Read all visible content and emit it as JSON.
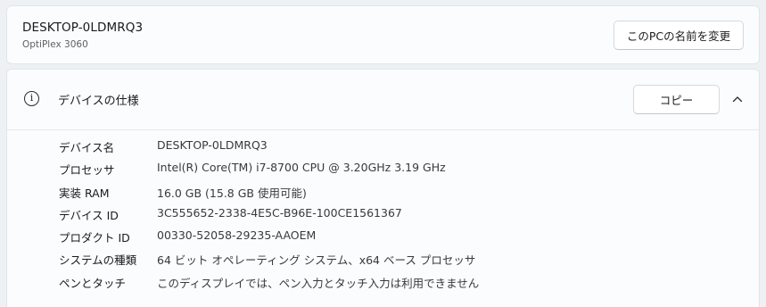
{
  "device": {
    "name": "DESKTOP-0LDMRQ3",
    "model": "OptiPlex 3060",
    "rename_label": "このPCの名前を変更"
  },
  "specs": {
    "title": "デバイスの仕様",
    "copy_label": "コピー",
    "icon": "info-icon",
    "expand_icon": "chevron-up-icon",
    "rows": [
      {
        "label": "デバイス名",
        "value": "DESKTOP-0LDMRQ3"
      },
      {
        "label": "プロセッサ",
        "value": "Intel(R) Core(TM) i7-8700 CPU @ 3.20GHz   3.19 GHz"
      },
      {
        "label": "実装 RAM",
        "value": "16.0 GB (15.8 GB 使用可能)"
      },
      {
        "label": "デバイス ID",
        "value": "3C555652-2338-4E5C-B96E-100CE1561367"
      },
      {
        "label": "プロダクト ID",
        "value": "00330-52058-29235-AAOEM"
      },
      {
        "label": "システムの種類",
        "value": "64 ビット オペレーティング システム、x64 ベース プロセッサ"
      },
      {
        "label": "ペンとタッチ",
        "value": "このディスプレイでは、ペン入力とタッチ入力は利用できません"
      }
    ]
  }
}
